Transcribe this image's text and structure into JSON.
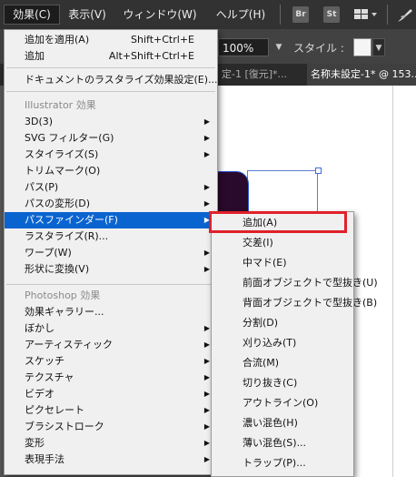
{
  "menubar": {
    "items": [
      "効果(C)",
      "表示(V)",
      "ウィンドウ(W)",
      "ヘルプ(H)"
    ],
    "active_item": "効果(C)",
    "bridge_label": "Br",
    "stock_label": "St"
  },
  "control_bar": {
    "zoom_value": "100%",
    "style_label": "スタイル :"
  },
  "document_tabs": {
    "tab1": "定-1 [復元]*...",
    "tab1_close": "×",
    "tab2": "名称未設定-1* @ 153..."
  },
  "effects_menu": {
    "apply": {
      "label": "追加を適用(A)",
      "shortcut": "Shift+Ctrl+E"
    },
    "add": {
      "label": "追加",
      "shortcut": "Alt+Shift+Ctrl+E"
    },
    "raster_settings": "ドキュメントのラスタライズ効果設定(E)...",
    "illustrator_section": "Illustrator 効果",
    "illustrator_items": [
      {
        "label": "3D(3)",
        "submenu": true
      },
      {
        "label": "SVG フィルター(G)",
        "submenu": true
      },
      {
        "label": "スタイライズ(S)",
        "submenu": true
      },
      {
        "label": "トリムマーク(O)",
        "submenu": false
      },
      {
        "label": "パス(P)",
        "submenu": true
      },
      {
        "label": "パスの変形(D)",
        "submenu": true
      },
      {
        "label": "パスファインダー(F)",
        "submenu": true
      },
      {
        "label": "ラスタライズ(R)...",
        "submenu": false
      },
      {
        "label": "ワープ(W)",
        "submenu": true
      },
      {
        "label": "形状に変換(V)",
        "submenu": true
      }
    ],
    "highlighted": "パスファインダー(F)",
    "photoshop_section": "Photoshop 効果",
    "photoshop_items": [
      {
        "label": "効果ギャラリー...",
        "submenu": false
      },
      {
        "label": "ぼかし",
        "submenu": true
      },
      {
        "label": "アーティスティック",
        "submenu": true
      },
      {
        "label": "スケッチ",
        "submenu": true
      },
      {
        "label": "テクスチャ",
        "submenu": true
      },
      {
        "label": "ビデオ",
        "submenu": true
      },
      {
        "label": "ピクセレート",
        "submenu": true
      },
      {
        "label": "ブラシストローク",
        "submenu": true
      },
      {
        "label": "変形",
        "submenu": true
      },
      {
        "label": "表現手法",
        "submenu": true
      }
    ]
  },
  "pathfinder_menu": {
    "items": [
      "追加(A)",
      "交差(I)",
      "中マド(E)",
      "前面オブジェクトで型抜き(U)",
      "背面オブジェクトで型抜き(B)",
      "分割(D)",
      "刈り込み(T)",
      "合流(M)",
      "切り抜き(C)",
      "アウトライン(O)",
      "濃い混色(H)",
      "薄い混色(S)...",
      "トラップ(P)..."
    ],
    "callout_target": "追加(A)"
  },
  "colors": {
    "highlight": "#0a64d0",
    "callout": "#e0212a",
    "art_fill": "#2a0a2c"
  }
}
